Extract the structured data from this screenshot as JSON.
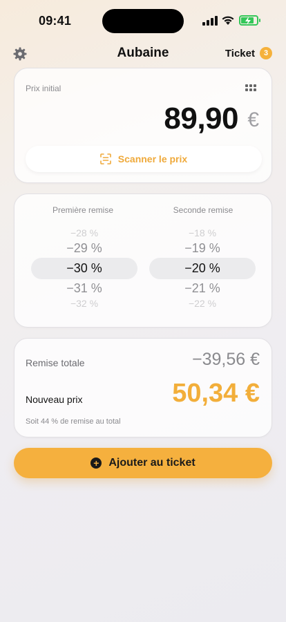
{
  "status": {
    "time": "09:41"
  },
  "nav": {
    "title": "Aubaine",
    "ticket_label": "Ticket",
    "ticket_count": "3"
  },
  "price_card": {
    "label": "Prix initial",
    "price": "89,90",
    "currency": "€",
    "scan_label": "Scanner le prix"
  },
  "picker": {
    "first": {
      "header": "Première remise",
      "options": [
        "−28 %",
        "−29 %",
        "−30 %",
        "−31 %",
        "−32 %"
      ],
      "selected": "−30 %"
    },
    "second": {
      "header": "Seconde remise",
      "options": [
        "−18 %",
        "−19 %",
        "−20 %",
        "−21 %",
        "−22 %"
      ],
      "selected": "−20 %"
    }
  },
  "totals": {
    "total_label": "Remise totale",
    "total_value": "−39,56 €",
    "new_label": "Nouveau prix",
    "new_value": "50,34 €",
    "note": "Soit 44 % de remise au total"
  },
  "add_button": {
    "label": "Ajouter au ticket"
  },
  "colors": {
    "accent": "#f5b03e",
    "battery": "#34c759"
  },
  "icons": [
    "signal-icon",
    "wifi-icon",
    "battery-icon",
    "gear-icon",
    "grid-icon",
    "scan-icon",
    "plus-icon"
  ]
}
